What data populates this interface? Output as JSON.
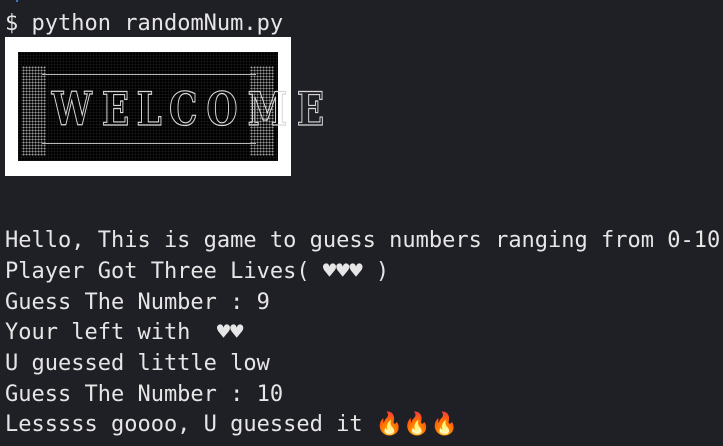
{
  "terminal": {
    "cutoff_prev_line": ";",
    "prompt": "$ ",
    "command": "python randomNum.py",
    "banner_text": "WELCOME",
    "output": [
      "Hello, This is game to guess numbers ranging from 0-10",
      "Player Got Three Lives( ♥♥♥ )",
      "Guess The Number : 9",
      "Your left with  ♥♥",
      "U guessed little low",
      "Guess The Number : 10",
      "Lesssss goooo, U guessed it 🔥🔥🔥"
    ]
  },
  "colors": {
    "background": "#1f1f26",
    "text": "#e6e6e6",
    "banner_border": "#ffffff",
    "banner_bg": "#000000"
  }
}
